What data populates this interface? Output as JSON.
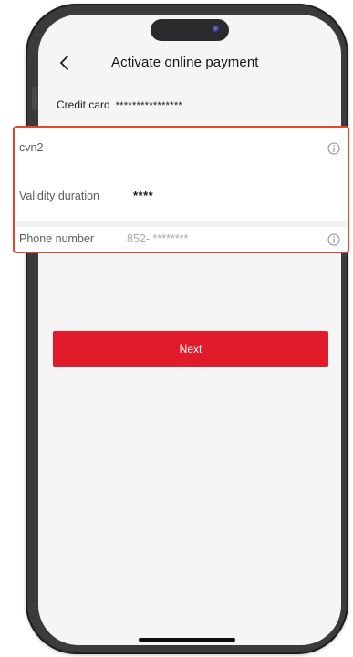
{
  "header": {
    "title": "Activate online payment",
    "back_icon": "chevron-left-icon"
  },
  "credit_card": {
    "label": "Credit card",
    "value": "****************"
  },
  "form": {
    "cvn2": {
      "label": "cvn2",
      "info_icon": "info-icon"
    },
    "validity": {
      "label": "Validity duration",
      "value": "****"
    },
    "phone": {
      "label": "Phone number",
      "value": "852- ********",
      "info_icon": "info-icon"
    }
  },
  "next_button": {
    "label": "Next"
  },
  "colors": {
    "primary_red": "#e21b2a",
    "highlight_border": "#e4472d",
    "screen_bg": "#f5f5f6"
  }
}
